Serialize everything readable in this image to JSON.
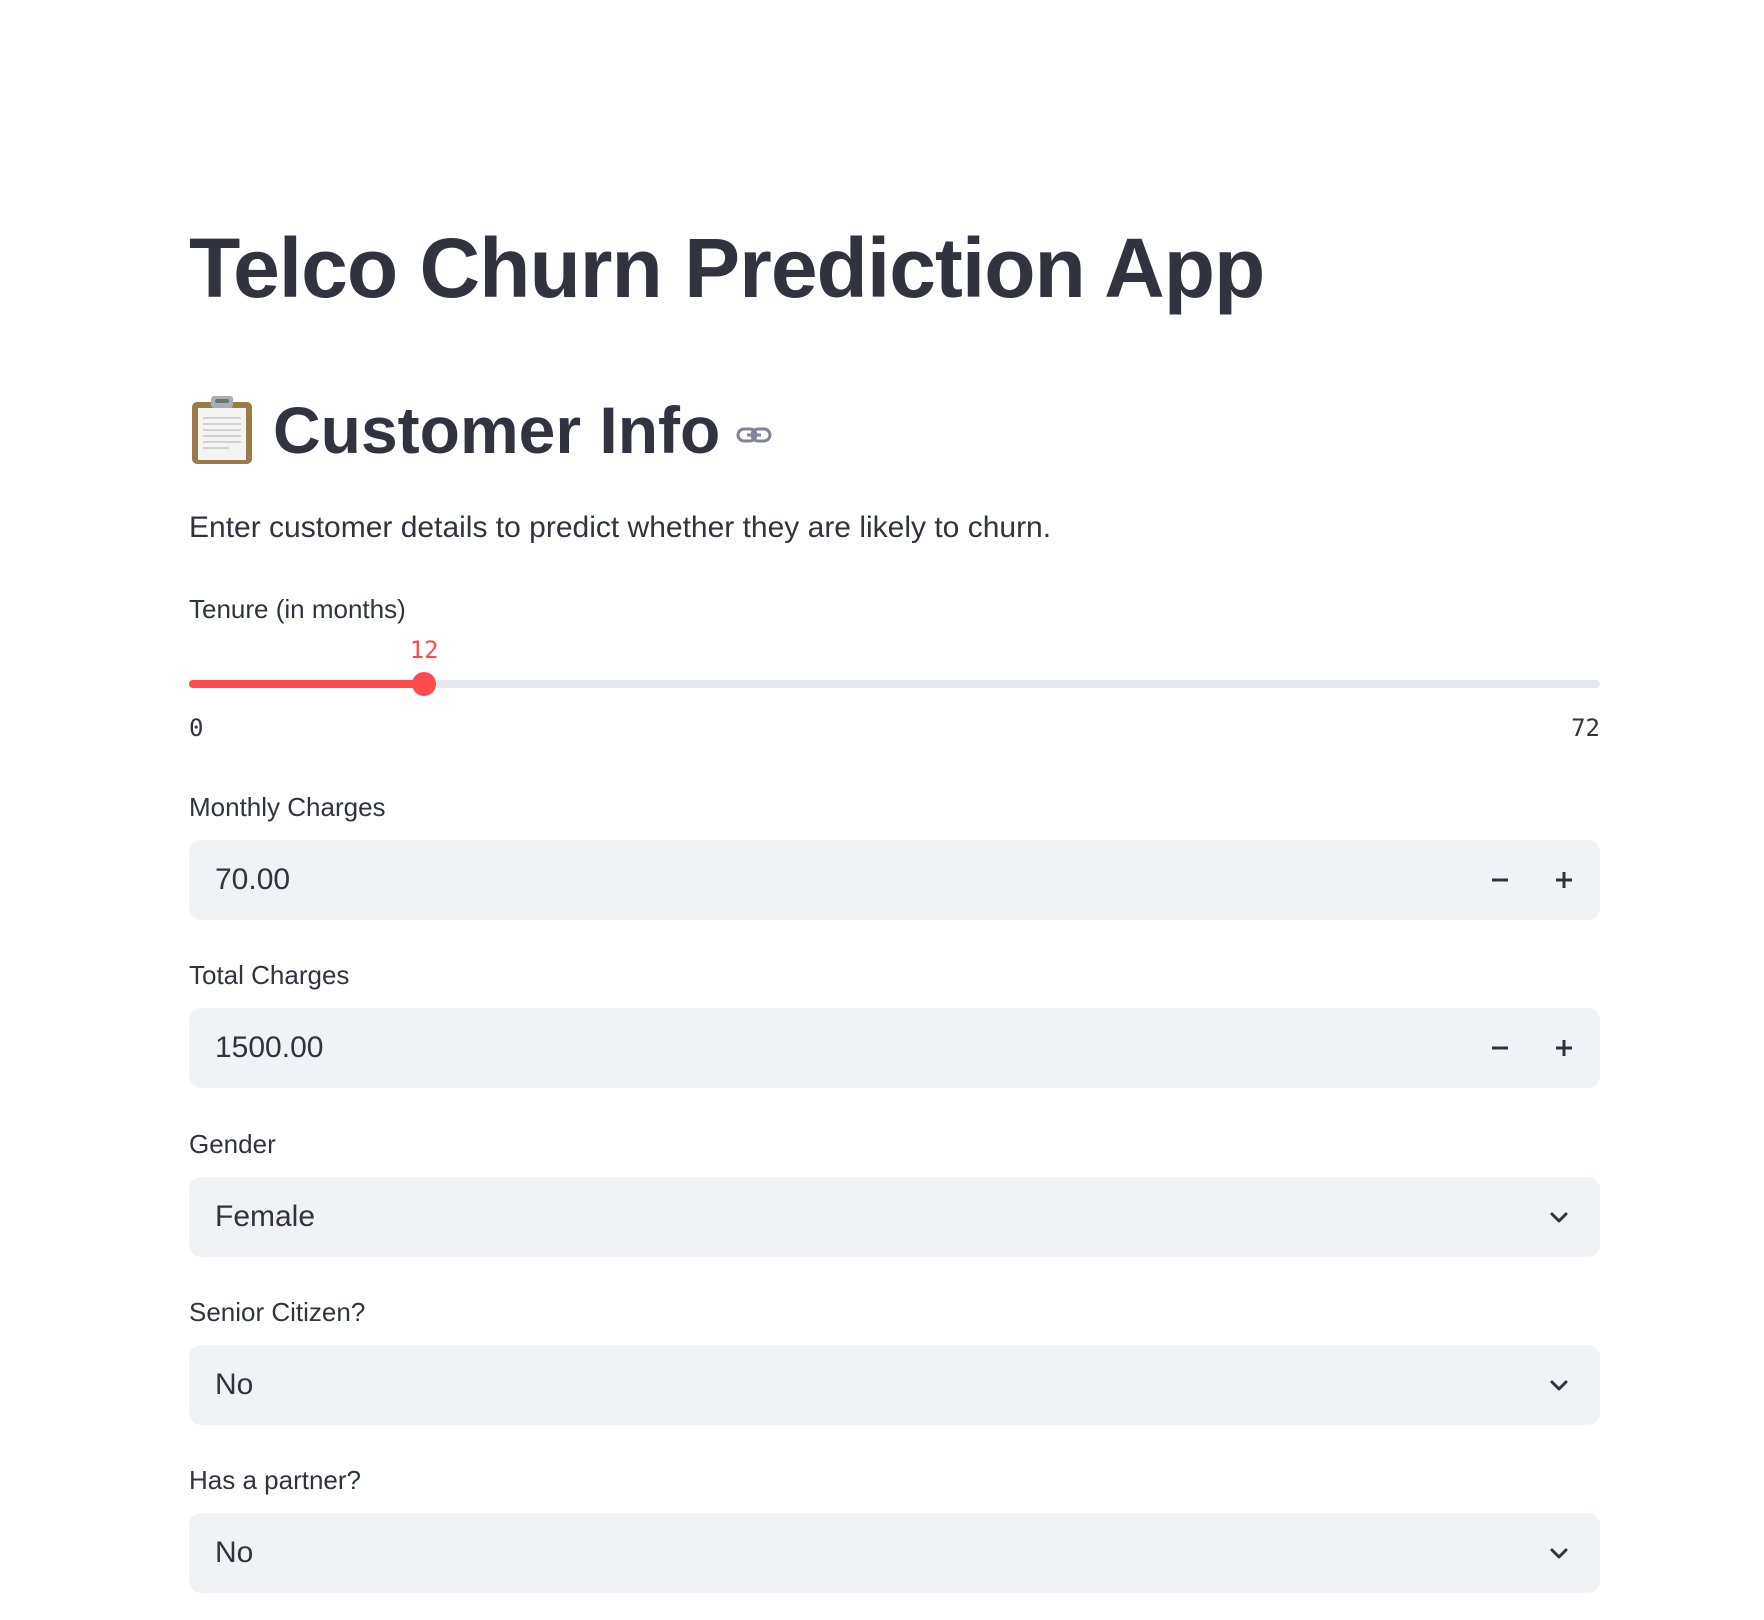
{
  "page": {
    "title": "Telco Churn Prediction App"
  },
  "section": {
    "heading": "Customer Info",
    "heading_icon": "clipboard-icon",
    "anchor_icon": "link-icon",
    "caption": "Enter customer details to predict whether they are likely to churn."
  },
  "tenure": {
    "label": "Tenure (in months)",
    "value": "12",
    "min": "0",
    "max": "72",
    "value_number": 12,
    "min_number": 0,
    "max_number": 72,
    "accent_color": "#ff4b4b"
  },
  "monthly_charges": {
    "label": "Monthly Charges",
    "value": "70.00"
  },
  "total_charges": {
    "label": "Total Charges",
    "value": "1500.00"
  },
  "gender": {
    "label": "Gender",
    "value": "Female"
  },
  "senior_citizen": {
    "label": "Senior Citizen?",
    "value": "No"
  },
  "partner": {
    "label": "Has a partner?",
    "value": "No"
  }
}
